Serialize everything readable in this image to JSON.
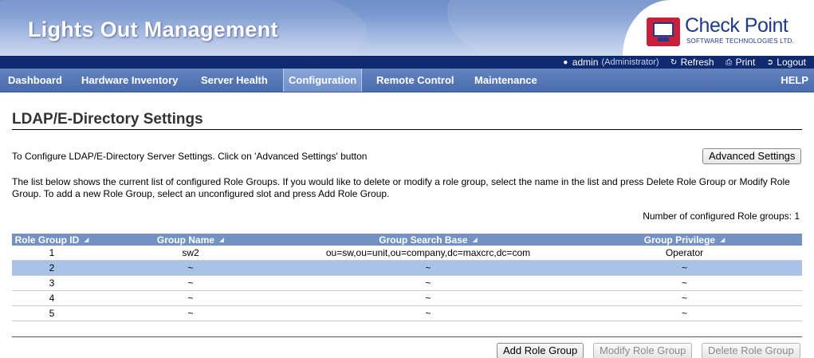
{
  "header": {
    "app_title": "Lights Out Management",
    "brand_name": "Check Point",
    "brand_tagline": "SOFTWARE TECHNOLOGIES LTD."
  },
  "user_strip": {
    "user": "admin",
    "role": "(Administrator)",
    "refresh_label": "Refresh",
    "print_label": "Print",
    "logout_label": "Logout"
  },
  "nav": {
    "items": [
      {
        "label": "Dashboard"
      },
      {
        "label": "Hardware Inventory"
      },
      {
        "label": "Server Health"
      },
      {
        "label": "Configuration"
      },
      {
        "label": "Remote Control"
      },
      {
        "label": "Maintenance"
      }
    ],
    "active": "Configuration",
    "help_label": "HELP"
  },
  "page": {
    "title": "LDAP/E-Directory Settings",
    "intro": "To Configure LDAP/E-Directory Server Settings. Click on 'Advanced Settings' button",
    "advanced_button": "Advanced Settings",
    "description": "The list below shows the current list of configured Role Groups. If you would like to delete or modify a role group, select the name in the list and press Delete Role Group or Modify Role Group. To add a new Role Group, select an unconfigured slot and press Add Role Group.",
    "count_text": "Number of configured Role groups: 1"
  },
  "table": {
    "columns": [
      "Role Group ID",
      "Group Name",
      "Group Search Base",
      "Group Privilege"
    ],
    "rows": [
      [
        "1",
        "sw2",
        "ou=sw,ou=unit,ou=company,dc=maxcrc,dc=com",
        "Operator"
      ],
      [
        "2",
        "~",
        "~",
        "~"
      ],
      [
        "3",
        "~",
        "~",
        "~"
      ],
      [
        "4",
        "~",
        "~",
        "~"
      ],
      [
        "5",
        "~",
        "~",
        "~"
      ]
    ],
    "selected_row": 1
  },
  "actions": {
    "add": "Add Role Group",
    "modify": "Modify Role Group",
    "delete": "Delete Role Group"
  },
  "colors": {
    "nav_bg": "#4b6cad",
    "user_strip_bg": "#0f2a6e",
    "table_header_bg": "#7491c3",
    "selected_row_bg": "#a9c3e6",
    "brand_red": "#c8203a",
    "brand_blue": "#1d3b8a"
  },
  "icons": {
    "user": "user-icon",
    "refresh": "refresh-icon",
    "print": "print-icon",
    "logout": "logout-icon",
    "sort": "sort-arrow-icon"
  }
}
